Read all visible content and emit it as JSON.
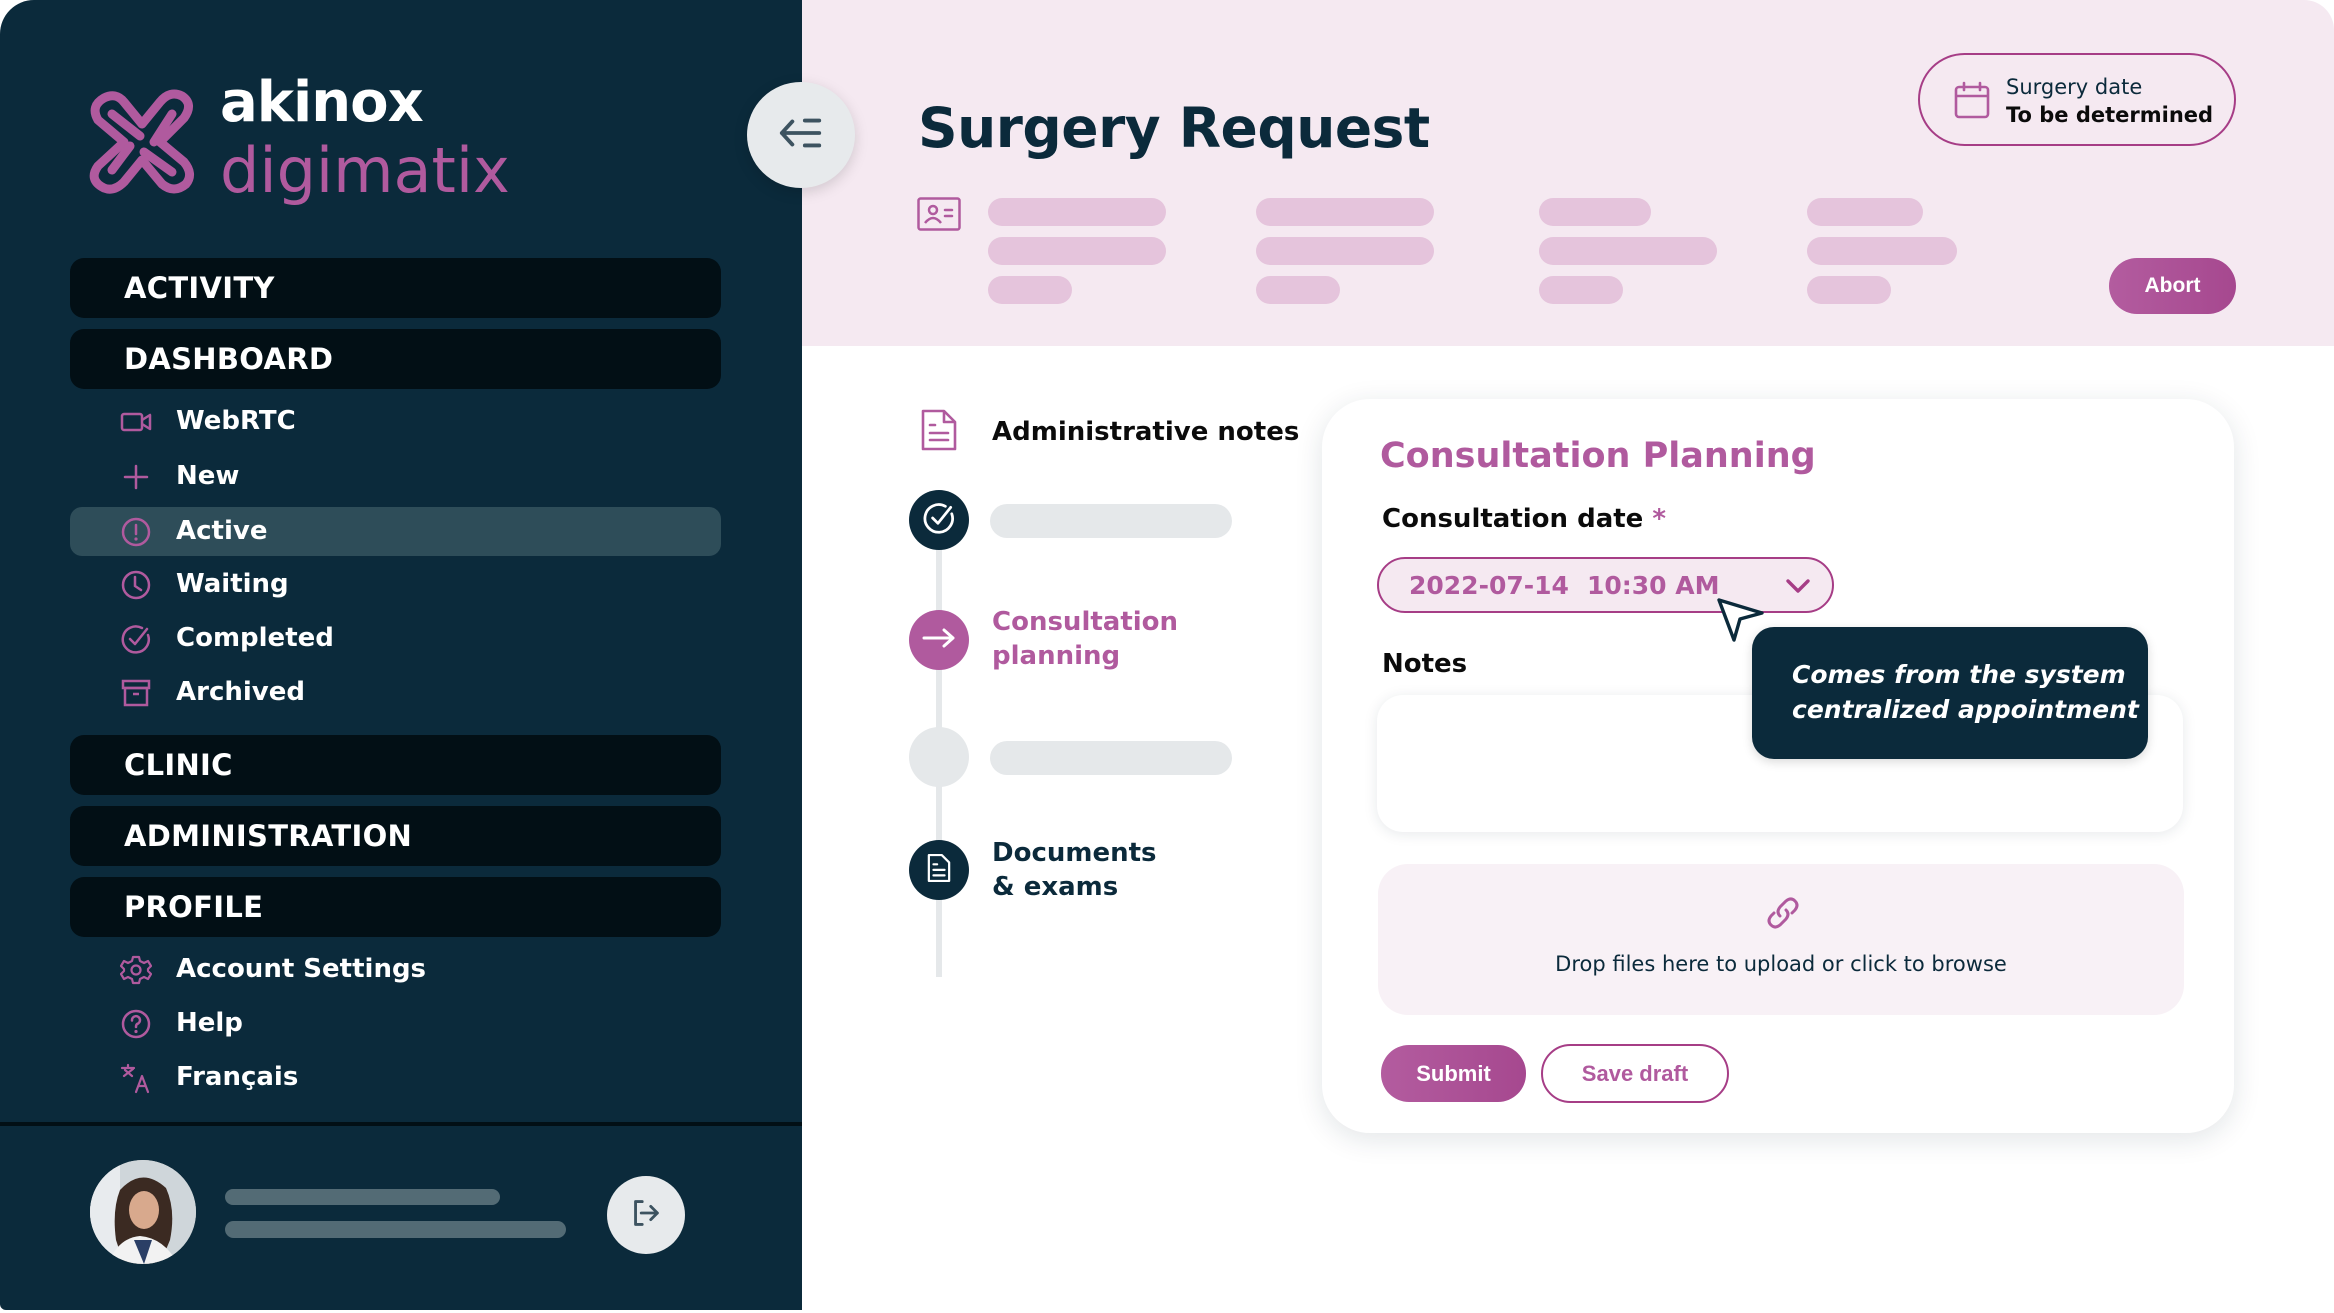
{
  "brand": {
    "name_top": "akinox",
    "name_bottom": "digimatix",
    "accent_color": "#b05a9e",
    "dark_color": "#0b2a3b"
  },
  "sidebar": {
    "sections": [
      {
        "label": "ACTIVITY"
      },
      {
        "label": "DASHBOARD",
        "items": [
          {
            "label": "WebRTC",
            "icon": "video-camera-icon"
          },
          {
            "label": "New",
            "icon": "plus-icon"
          },
          {
            "label": "Active",
            "icon": "alert-circle-icon",
            "active": true
          },
          {
            "label": "Waiting",
            "icon": "clock-icon"
          },
          {
            "label": "Completed",
            "icon": "check-circle-icon"
          },
          {
            "label": "Archived",
            "icon": "archive-box-icon"
          }
        ]
      },
      {
        "label": "CLINIC"
      },
      {
        "label": "ADMINISTRATION"
      },
      {
        "label": "PROFILE",
        "items": [
          {
            "label": "Account Settings",
            "icon": "gear-icon"
          },
          {
            "label": "Help",
            "icon": "help-circle-icon"
          },
          {
            "label": "Français",
            "icon": "translate-icon"
          }
        ]
      }
    ],
    "user": {
      "avatar": "user-photo",
      "logout_icon": "logout-icon"
    }
  },
  "header": {
    "title": "Surgery Request",
    "surgery_date": {
      "label": "Surgery date",
      "value": "To be determined"
    },
    "abort_label": "Abort"
  },
  "stepper": {
    "admin_notes_label": "Administrative notes",
    "steps": [
      {
        "state": "completed",
        "label": ""
      },
      {
        "state": "current",
        "label_line1": "Consultation",
        "label_line2": "planning"
      },
      {
        "state": "pending",
        "label": ""
      },
      {
        "state": "documents",
        "label_line1": "Documents",
        "label_line2": "& exams"
      }
    ]
  },
  "form": {
    "title": "Consultation Planning",
    "date_label": "Consultation date",
    "required_mark": "*",
    "date_value": "2022-07-14",
    "time_value": "10:30 AM",
    "notes_label": "Notes",
    "notes_value": "",
    "tooltip_line1": "Comes from the system",
    "tooltip_line2": "centralized appointment",
    "dropzone_text": "Drop files here to upload or click to browse",
    "submit_label": "Submit",
    "save_draft_label": "Save draft"
  }
}
